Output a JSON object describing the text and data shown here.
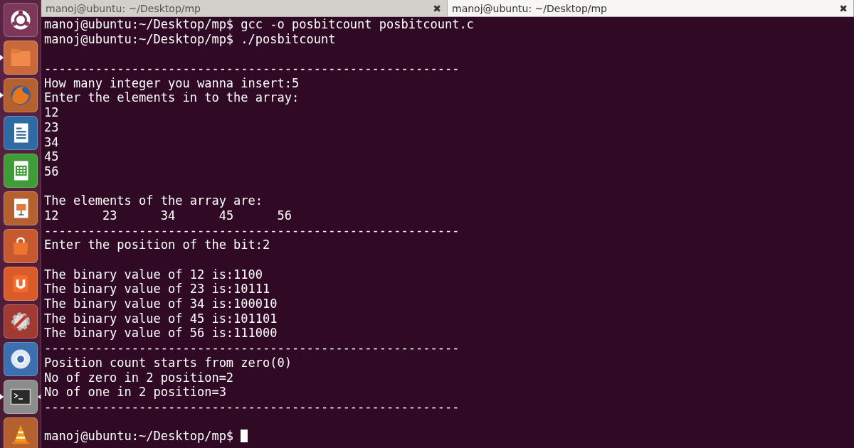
{
  "launcher": {
    "items": [
      {
        "kind": "home",
        "running": false,
        "active": false
      },
      {
        "kind": "folder",
        "running": true,
        "active": false
      },
      {
        "kind": "fox",
        "running": true,
        "active": false
      },
      {
        "kind": "writer",
        "running": false,
        "active": false
      },
      {
        "kind": "calc",
        "running": false,
        "active": false
      },
      {
        "kind": "impress",
        "running": false,
        "active": false
      },
      {
        "kind": "bag",
        "running": false,
        "active": false
      },
      {
        "kind": "u",
        "running": false,
        "active": false
      },
      {
        "kind": "tools",
        "running": false,
        "active": false
      },
      {
        "kind": "globe",
        "running": false,
        "active": false
      },
      {
        "kind": "terminal",
        "running": true,
        "active": true
      },
      {
        "kind": "cone",
        "running": false,
        "active": false
      }
    ]
  },
  "tabs": [
    {
      "title": "manoj@ubuntu: ~/Desktop/mp",
      "close": "✖",
      "selected": false
    },
    {
      "title": "manoj@ubuntu: ~/Desktop/mp",
      "close": "✖",
      "selected": true
    }
  ],
  "terminal": {
    "lines": [
      {
        "kind": "text",
        "text": "manoj@ubuntu:~/Desktop/mp$ gcc -o posbitcount posbitcount.c"
      },
      {
        "kind": "text",
        "text": "manoj@ubuntu:~/Desktop/mp$ ./posbitcount"
      },
      {
        "kind": "blank"
      },
      {
        "kind": "text",
        "text": "---------------------------------------------------------"
      },
      {
        "kind": "text",
        "text": "How many integer you wanna insert:5"
      },
      {
        "kind": "text",
        "text": "Enter the elements in to the array:"
      },
      {
        "kind": "text",
        "text": "12"
      },
      {
        "kind": "text",
        "text": "23"
      },
      {
        "kind": "text",
        "text": "34"
      },
      {
        "kind": "text",
        "text": "45"
      },
      {
        "kind": "text",
        "text": "56"
      },
      {
        "kind": "blank"
      },
      {
        "kind": "text",
        "text": "The elements of the array are:"
      },
      {
        "kind": "text",
        "text": "12\t23\t34\t45\t56"
      },
      {
        "kind": "text",
        "text": "---------------------------------------------------------"
      },
      {
        "kind": "text",
        "text": "Enter the position of the bit:2"
      },
      {
        "kind": "blank"
      },
      {
        "kind": "text",
        "text": "The binary value of 12 is:1100"
      },
      {
        "kind": "text",
        "text": "The binary value of 23 is:10111"
      },
      {
        "kind": "text",
        "text": "The binary value of 34 is:100010"
      },
      {
        "kind": "text",
        "text": "The binary value of 45 is:101101"
      },
      {
        "kind": "text",
        "text": "The binary value of 56 is:111000"
      },
      {
        "kind": "text",
        "text": "---------------------------------------------------------"
      },
      {
        "kind": "text",
        "text": "Position count starts from zero(0)"
      },
      {
        "kind": "text",
        "text": "No of zero in 2 position=2"
      },
      {
        "kind": "text",
        "text": "No of one in 2 position=3"
      },
      {
        "kind": "text",
        "text": "---------------------------------------------------------"
      },
      {
        "kind": "blank"
      },
      {
        "kind": "prompt",
        "text": "manoj@ubuntu:~/Desktop/mp$ ",
        "cursor": true
      }
    ]
  }
}
